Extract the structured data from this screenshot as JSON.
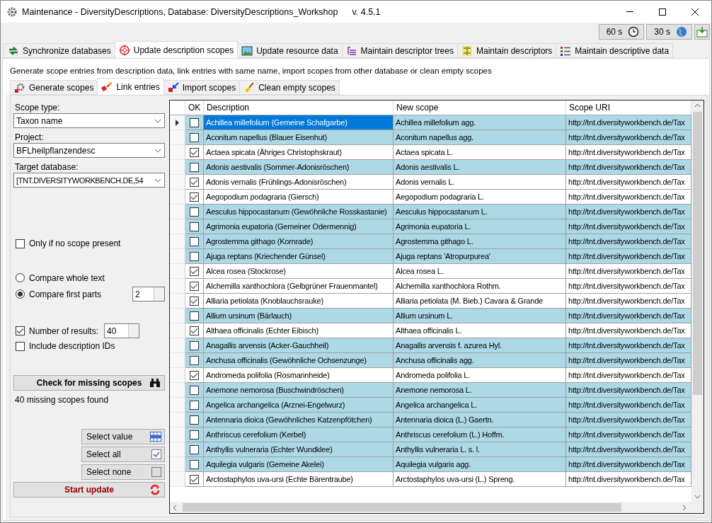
{
  "window": {
    "title": "Maintenance - DiversityDescriptions,  Database: DiversityDescriptions_Workshop",
    "version": "v. 4.5.1"
  },
  "timers": [
    {
      "label": "60 s",
      "kind": "clock"
    },
    {
      "label": "30 s",
      "kind": "globe"
    }
  ],
  "tabs": [
    {
      "label": "Synchronize databases",
      "selected": false,
      "kind": "sync"
    },
    {
      "label": "Update description scopes",
      "selected": true,
      "kind": "target"
    },
    {
      "label": "Update resource data",
      "selected": false,
      "kind": "image"
    },
    {
      "label": "Maintain descriptor trees",
      "selected": false,
      "kind": "tree"
    },
    {
      "label": "Maintain descriptors",
      "selected": false,
      "kind": "descriptor"
    },
    {
      "label": "Maintain descriptive data",
      "selected": false,
      "kind": "data"
    }
  ],
  "intro": "Generate scope entries from description data, link entries with same name, import scopes from other database or clean empty scopes",
  "subtabs": [
    {
      "label": "Generate scopes",
      "selected": false,
      "kind": "gear"
    },
    {
      "label": "Link entries",
      "selected": true,
      "kind": "link"
    },
    {
      "label": "Import scopes",
      "selected": false,
      "kind": "import"
    },
    {
      "label": "Clean empty scopes",
      "selected": false,
      "kind": "broom"
    }
  ],
  "options": {
    "scope_type": {
      "label": "Scope type:",
      "value": "Taxon name"
    },
    "project": {
      "label": "Project:",
      "value": "BFLheilpflanzendesc"
    },
    "target_database": {
      "label": "Target database:",
      "value": "[TNT.DIVERSITYWORKBENCH.DE,54"
    },
    "only_if_no_scope": {
      "label": "Only if no scope present",
      "checked": false
    },
    "compare": [
      {
        "label": "Compare whole text",
        "selected": false
      },
      {
        "label": "Compare first parts",
        "selected": true
      }
    ],
    "first_parts": "2",
    "number_of_results": {
      "label": "Number of results:",
      "checked": true,
      "value": "40"
    },
    "include_ids": {
      "label": "Include description IDs",
      "checked": false
    },
    "check_button": "Check for missing scopes",
    "status": "40 missing scopes found",
    "select_buttons": [
      {
        "label": "Select value",
        "kind": "grid"
      },
      {
        "label": "Select all",
        "kind": "all"
      },
      {
        "label": "Select none",
        "kind": "none"
      }
    ],
    "start_button": "Start update"
  },
  "grid": {
    "columns": [
      "OK",
      "Description",
      "New scope",
      "Scope URI"
    ],
    "rows": [
      {
        "ok": false,
        "selected": true,
        "description": "Achillea millefolium (Gemeine Schafgarbe)",
        "new_scope": "Achillea millefolium agg.",
        "scope_uri": "http://tnt.diversityworkbench.de/Tax"
      },
      {
        "ok": false,
        "selected": false,
        "description": "Aconitum napellus (Blauer Eisenhut)",
        "new_scope": "Aconitum napellus agg.",
        "scope_uri": "http://tnt.diversityworkbench.de/Tax"
      },
      {
        "ok": true,
        "selected": false,
        "description": "Actaea spicata (Ähriges Christophskraut)",
        "new_scope": "Actaea spicata L.",
        "scope_uri": "http://tnt.diversityworkbench.de/Tax"
      },
      {
        "ok": false,
        "selected": false,
        "description": "Adonis aestivalis (Sommer-Adonisröschen)",
        "new_scope": "Adonis aestivalis L.",
        "scope_uri": "http://tnt.diversityworkbench.de/Tax"
      },
      {
        "ok": true,
        "selected": false,
        "description": "Adonis vernalis (Frühlings-Adonisröschen)",
        "new_scope": "Adonis vernalis L.",
        "scope_uri": "http://tnt.diversityworkbench.de/Tax"
      },
      {
        "ok": true,
        "selected": false,
        "description": "Aegopodium podagraria (Giersch)",
        "new_scope": "Aegopodium podagraria L.",
        "scope_uri": "http://tnt.diversityworkbench.de/Tax"
      },
      {
        "ok": false,
        "selected": false,
        "description": "Aesculus hippocastanum (Gewöhnliche Rosskastanie)",
        "new_scope": "Aesculus hippocastanum L.",
        "scope_uri": "http://tnt.diversityworkbench.de/Tax"
      },
      {
        "ok": false,
        "selected": false,
        "description": "Agrimonia eupatoria (Gemeiner Odermennig)",
        "new_scope": "Agrimonia eupatoria L.",
        "scope_uri": "http://tnt.diversityworkbench.de/Tax"
      },
      {
        "ok": false,
        "selected": false,
        "description": "Agrostemma githago (Kornrade)",
        "new_scope": "Agrostemma githago L.",
        "scope_uri": "http://tnt.diversityworkbench.de/Tax"
      },
      {
        "ok": false,
        "selected": false,
        "description": "Ajuga reptans (Kriechender Günsel)",
        "new_scope": "Ajuga reptans 'Atropurpurea'",
        "scope_uri": "http://tnt.diversityworkbench.de/Tax"
      },
      {
        "ok": true,
        "selected": false,
        "description": "Alcea rosea (Stockrose)",
        "new_scope": "Alcea rosea L.",
        "scope_uri": "http://tnt.diversityworkbench.de/Tax"
      },
      {
        "ok": true,
        "selected": false,
        "description": "Alchemilla xanthochlora (Gelbgrüner Frauenmantel)",
        "new_scope": "Alchemilla xanthochlora Rothm.",
        "scope_uri": "http://tnt.diversityworkbench.de/Tax"
      },
      {
        "ok": true,
        "selected": false,
        "description": "Alliaria petiolata (Knoblauchsrauke)",
        "new_scope": "Alliaria petiolata (M. Bieb.) Cavara & Grande",
        "scope_uri": "http://tnt.diversityworkbench.de/Tax"
      },
      {
        "ok": false,
        "selected": false,
        "description": "Allium ursinum (Bärlauch)",
        "new_scope": "Allium ursinum L.",
        "scope_uri": "http://tnt.diversityworkbench.de/Tax"
      },
      {
        "ok": true,
        "selected": false,
        "description": "Althaea officinalis (Echter Eibisch)",
        "new_scope": "Althaea officinalis L.",
        "scope_uri": "http://tnt.diversityworkbench.de/Tax"
      },
      {
        "ok": false,
        "selected": false,
        "description": "Anagallis arvensis (Acker-Gauchheil)",
        "new_scope": "Anagallis arvensis f. azurea Hyl.",
        "scope_uri": "http://tnt.diversityworkbench.de/Tax"
      },
      {
        "ok": false,
        "selected": false,
        "description": "Anchusa officinalis (Gewöhnliche Ochsenzunge)",
        "new_scope": "Anchusa officinalis agg.",
        "scope_uri": "http://tnt.diversityworkbench.de/Tax"
      },
      {
        "ok": true,
        "selected": false,
        "description": "Andromeda polifolia (Rosmarinheide)",
        "new_scope": "Andromeda polifolia L.",
        "scope_uri": "http://tnt.diversityworkbench.de/Tax"
      },
      {
        "ok": false,
        "selected": false,
        "description": "Anemone nemorosa (Buschwindröschen)",
        "new_scope": "Anemone nemorosa L.",
        "scope_uri": "http://tnt.diversityworkbench.de/Tax"
      },
      {
        "ok": false,
        "selected": false,
        "description": "Angelica archangelica (Arznei-Engelwurz)",
        "new_scope": "Angelica archangelica L.",
        "scope_uri": "http://tnt.diversityworkbench.de/Tax"
      },
      {
        "ok": false,
        "selected": false,
        "description": "Antennaria dioica (Gewöhnliches Katzenpfötchen)",
        "new_scope": "Antennaria dioica (L.) Gaertn.",
        "scope_uri": "http://tnt.diversityworkbench.de/Tax"
      },
      {
        "ok": false,
        "selected": false,
        "description": "Anthriscus cerefolium (Kerbel)",
        "new_scope": "Anthriscus cerefolium (L.) Hoffm.",
        "scope_uri": "http://tnt.diversityworkbench.de/Tax"
      },
      {
        "ok": false,
        "selected": false,
        "description": "Anthyllis vulneraria (Echter Wundklee)",
        "new_scope": "Anthyllis vulneraria L. s. l.",
        "scope_uri": "http://tnt.diversityworkbench.de/Tax"
      },
      {
        "ok": false,
        "selected": false,
        "description": "Aquilegia vulgaris (Gemeine Akelei)",
        "new_scope": "Aquilegia vulgaris agg.",
        "scope_uri": "http://tnt.diversityworkbench.de/Tax"
      },
      {
        "ok": true,
        "selected": false,
        "description": "Arctostaphylos uva-ursi (Echte Bärentraube)",
        "new_scope": "Arctostaphylos uva-ursi (L.) Spreng.",
        "scope_uri": "http://tnt.diversityworkbench.de/Tax"
      }
    ]
  }
}
